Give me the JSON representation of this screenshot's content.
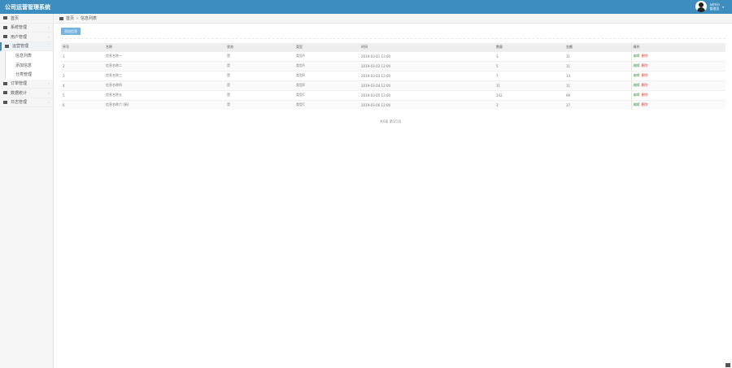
{
  "header": {
    "title": "公司运营管理系统",
    "user_name": "admin",
    "user_role": "管理员"
  },
  "breadcrumb": {
    "home": "首页",
    "current": "信息列表"
  },
  "sidebar": {
    "items": [
      {
        "label": "首页"
      },
      {
        "label": "系统管理"
      },
      {
        "label": "用户管理"
      },
      {
        "label": "运营管理"
      }
    ],
    "subitems": [
      {
        "label": "信息列表"
      },
      {
        "label": "添加信息"
      },
      {
        "label": "分类管理"
      }
    ],
    "items2": [
      {
        "label": "订单管理"
      },
      {
        "label": "数据统计"
      },
      {
        "label": "日志管理"
      }
    ]
  },
  "toolbar": {
    "add_label": "添加信息"
  },
  "table": {
    "headers": [
      "序号",
      "名称",
      "状态",
      "类型",
      "时间",
      "数量",
      "金额",
      "操作"
    ],
    "rows": [
      [
        "1",
        "信息名称一",
        "是",
        "类型A",
        "2019-03-01 12:00",
        "3",
        "11"
      ],
      [
        "2",
        "信息名称二",
        "是",
        "类型A",
        "2019-03-02 12:00",
        "5",
        "11"
      ],
      [
        "3",
        "信息名称三",
        "是",
        "类型B",
        "2019-03-03 12:00",
        "7",
        "14"
      ],
      [
        "4",
        "信息名称四",
        "是",
        "类型B",
        "2019-03-04 12:00",
        "11",
        "11"
      ],
      [
        "5",
        "信息名称五",
        "是",
        "类型C",
        "2019-03-05 12:00",
        "142",
        "99"
      ],
      [
        "6",
        "信息名称六 (新)",
        "是",
        "类型C",
        "2019-03-06 12:00",
        "3",
        "37"
      ]
    ],
    "edit_label": "编辑",
    "delete_label": "删除"
  },
  "pager": {
    "text": "共6条 第1/1页"
  }
}
